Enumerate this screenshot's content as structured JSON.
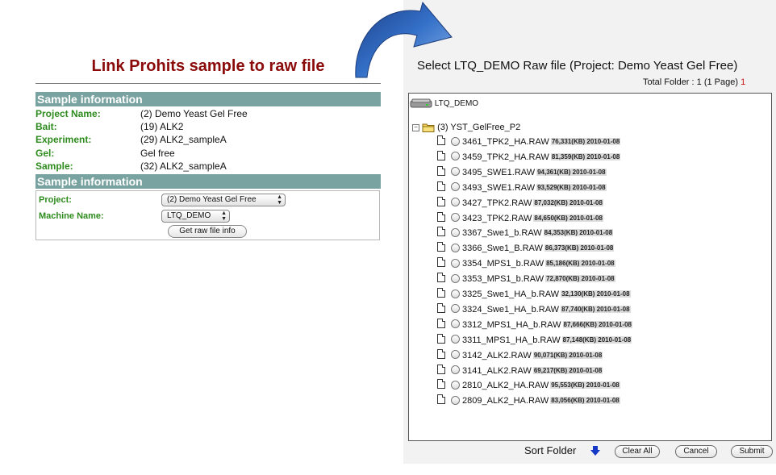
{
  "left": {
    "title": "Link Prohits sample to raw file",
    "section1_title": "Sample information",
    "info": [
      {
        "label": "Project Name:",
        "value": "(2) Demo Yeast Gel Free"
      },
      {
        "label": "Bait:",
        "value": "(19) ALK2"
      },
      {
        "label": "Experiment:",
        "value": "(29) ALK2_sampleA"
      },
      {
        "label": "Gel:",
        "value": "Gel free"
      },
      {
        "label": "Sample:",
        "value": "(32) ALK2_sampleA"
      }
    ],
    "section2_title": "Sample information",
    "form": {
      "project_label": "Project:",
      "project_value": "(2) Demo Yeast Gel Free",
      "machine_label": "Machine Name:",
      "machine_value": "LTQ_DEMO",
      "get_button": "Get raw file info"
    }
  },
  "right": {
    "title": "Select LTQ_DEMO Raw file (Project: Demo Yeast Gel Free)",
    "total_folder_label": "Total Folder : 1 (1 Page)",
    "total_folder_page": "1",
    "root_label": "LTQ_DEMO",
    "folder_label": "(3) YST_GelFree_P2",
    "files": [
      {
        "name": "3461_TPK2_HA.RAW",
        "meta": "76,331(KB) 2010-01-08"
      },
      {
        "name": "3459_TPK2_HA.RAW",
        "meta": "81,359(KB) 2010-01-08"
      },
      {
        "name": "3495_SWE1.RAW",
        "meta": "94,361(KB) 2010-01-08"
      },
      {
        "name": "3493_SWE1.RAW",
        "meta": "93,529(KB) 2010-01-08"
      },
      {
        "name": "3427_TPK2.RAW",
        "meta": "87,032(KB) 2010-01-08"
      },
      {
        "name": "3423_TPK2.RAW",
        "meta": "84,650(KB) 2010-01-08"
      },
      {
        "name": "3367_Swe1_b.RAW",
        "meta": "84,353(KB) 2010-01-08"
      },
      {
        "name": "3366_Swe1_B.RAW",
        "meta": "86,373(KB) 2010-01-08"
      },
      {
        "name": "3354_MPS1_b.RAW",
        "meta": "85,186(KB) 2010-01-08"
      },
      {
        "name": "3353_MPS1_b.RAW",
        "meta": "72,870(KB) 2010-01-08"
      },
      {
        "name": "3325_Swe1_HA_b.RAW",
        "meta": "32,130(KB) 2010-01-08"
      },
      {
        "name": "3324_Swe1_HA_b.RAW",
        "meta": "87,740(KB) 2010-01-08"
      },
      {
        "name": "3312_MPS1_HA_b.RAW",
        "meta": "87,666(KB) 2010-01-08"
      },
      {
        "name": "3311_MPS1_HA_b.RAW",
        "meta": "87,148(KB) 2010-01-08"
      },
      {
        "name": "3142_ALK2.RAW",
        "meta": "90,071(KB) 2010-01-08"
      },
      {
        "name": "3141_ALK2.RAW",
        "meta": "69,217(KB) 2010-01-08"
      },
      {
        "name": "2810_ALK2_HA.RAW",
        "meta": "95,553(KB) 2010-01-08"
      },
      {
        "name": "2809_ALK2_HA.RAW",
        "meta": "83,056(KB) 2010-01-08"
      }
    ],
    "sort_label": "Sort Folder",
    "buttons": {
      "clear": "Clear All",
      "cancel": "Cancel",
      "submit": "Submit"
    }
  },
  "colors": {
    "title_red": "#8b0b0b",
    "section_teal": "#79a3a0",
    "label_green": "#2e8b1e",
    "arrow_blue": "#2f62b8"
  }
}
